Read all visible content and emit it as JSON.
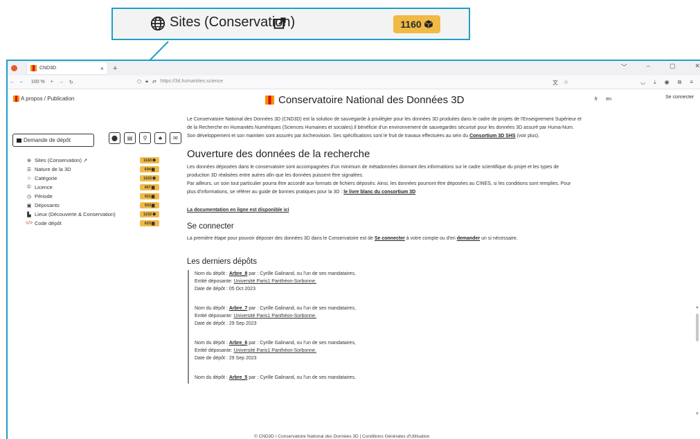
{
  "callout": {
    "label": "Sites (Conservation)",
    "count": "1160"
  },
  "browser": {
    "tab_title": "CND3D",
    "zoom": "100 %",
    "url": "https://3d.humanities.science",
    "window_controls": [
      "﹀",
      "–",
      "▢",
      "✕"
    ]
  },
  "header": {
    "apropos": "A propos / Publication",
    "title": "Conservatoire National des Données 3D",
    "lang_fr": "fr",
    "lang_en": "en",
    "login": "Se connecter"
  },
  "sidebar": {
    "depot_button": "Demande de dépôt",
    "items": [
      {
        "label": "Sites (Conservation)",
        "icon": "globe-icon",
        "badge": "1160",
        "badge_icon": "cube-icon"
      },
      {
        "label": "Nature de la 3D",
        "icon": "list-icon",
        "badge": "694",
        "badge_icon": "box-icon"
      },
      {
        "label": "Catégorie",
        "icon": "museum-icon",
        "badge": "1163",
        "badge_icon": "cube-icon"
      },
      {
        "label": "Licence",
        "icon": "copyright-icon",
        "badge": "667",
        "badge_icon": "box-icon"
      },
      {
        "label": "Période",
        "icon": "clock-icon",
        "badge": "611",
        "badge_icon": "box-icon"
      },
      {
        "label": "Déposants",
        "icon": "id-card-icon",
        "badge": "933",
        "badge_icon": "box-icon"
      },
      {
        "label": "Lieux (Découverte & Conservation)",
        "icon": "map-icon",
        "badge": "1232",
        "badge_icon": "cube-icon"
      },
      {
        "label": "Code dépôt",
        "icon": "code-icon",
        "badge": "623",
        "badge_icon": "box-icon"
      }
    ]
  },
  "intro": {
    "line1": "Le Conservatoire National des Données 3D (CND3D) est la solution de sauvegarde à privilégier pour les données 3D produites dans le cadre de projets de l'Enseignement Supérieur et",
    "line2": "de la Recherche en Humanités Numériques (Sciences Humaines et sociales).Il bénéficie d'un environnement de sauvegardes sécurisé pour les données 3D assuré par Huma-Num.",
    "line3": "Son développement et son maintien sont assurés par Archeovision. Ses spécifications sont le fruit de travaux effectuées au sein du",
    "link": "Consortium 3D SHS",
    "suffix": "(voir plus)."
  },
  "open_data": {
    "heading": "Ouverture des données de la recherche",
    "line1": "Les données déposées dans le conservatoire sont accompagnées d'un minimum de métadonnées donnant des informations sur le cadre scientifique du projet et les types de",
    "line2": "production 3D réalisées entre autres afin que les données puissent être signalées.",
    "line3": "Par ailleurs, un soin tout particulier pourra être accordé aux formats de fichiers déposés. Ainsi, les données pourront être déposées au CINES, si les conditions sont remplies. Pour",
    "line4": "plus d'informations, se référer au guide de bonnes pratiques pour la 3D :",
    "link": "le livre blanc du consortium 3D",
    "doc_link": "La documentation en ligne est disponible ici"
  },
  "connect": {
    "heading": "Se connecter",
    "text_before": "La première étape pour pouvoir déposer des données 3D dans le Conservatoire est de",
    "link1": "Se connecter",
    "text_mid": "à votre compte ou d'en",
    "link2": "demander",
    "text_after": "un si nécessaire."
  },
  "last_deposits": {
    "heading": "Les derniers dépôts",
    "name_label": "Nom du dépôt :",
    "par": "par : Cyrille Galinand, ou l'un de ses mandataires,",
    "entity_label": "Entité déposante:",
    "date_label": "Date de dépôt :",
    "items": [
      {
        "name": "Arbre_8",
        "entity": "Université Paris1 Panthéon-Sorbonne.",
        "date": "05 Oct 2023"
      },
      {
        "name": "Arbre_7",
        "entity": "Université Paris1 Panthéon-Sorbonne.",
        "date": "29 Sep 2023"
      },
      {
        "name": "Arbre_6",
        "entity": "Université Paris1 Panthéon-Sorbonne.",
        "date": "29 Sep 2023"
      },
      {
        "name": "Arbre_5",
        "entity": "",
        "date": ""
      }
    ]
  },
  "footer": {
    "text": "© CND3D / Conservatoire National des Données 3D | Conditions Générales d'Utilisation"
  },
  "colors": {
    "accent": "#1e9fc2",
    "badge": "#f0ba45"
  }
}
